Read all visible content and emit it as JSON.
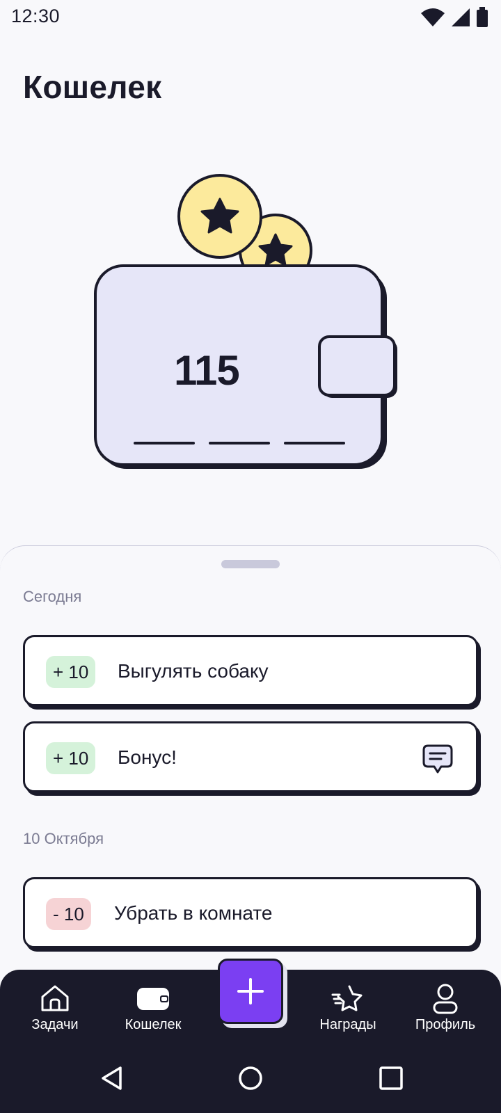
{
  "status_bar": {
    "time": "12:30",
    "icons": [
      "wifi-icon",
      "cellular-signal-icon",
      "battery-icon"
    ]
  },
  "header": {
    "title": "Кошелек"
  },
  "wallet": {
    "balance": "115",
    "illustration_icons": [
      "star-coin-icon",
      "star-coin-icon",
      "wallet-icon"
    ]
  },
  "colors": {
    "background": "#F8F8FB",
    "ink": "#1A1A2A",
    "wallet_fill": "#E6E6F8",
    "coin_fill": "#FCEA9C",
    "plus_badge": "#D5F2DA",
    "minus_badge": "#F6D3D5",
    "accent": "#7B3FF2"
  },
  "transactions": {
    "groups": [
      {
        "date": "Сегодня",
        "items": [
          {
            "amount": "+ 10",
            "title": "Выгулять собаку",
            "type": "plus",
            "has_comment": false
          },
          {
            "amount": "+ 10",
            "title": "Бонус!",
            "type": "plus",
            "has_comment": true,
            "comment_icon": "message-icon"
          }
        ]
      },
      {
        "date": "10 Октября",
        "items": [
          {
            "amount": "- 10",
            "title": "Убрать в комнате",
            "type": "minus",
            "has_comment": false
          }
        ]
      }
    ]
  },
  "bottom_nav": {
    "items": [
      {
        "label": "Задачи",
        "icon": "home-icon"
      },
      {
        "label": "Кошелек",
        "icon": "wallet-icon",
        "active": true
      },
      {
        "label": "Награды",
        "icon": "star-icon"
      },
      {
        "label": "Профиль",
        "icon": "profile-icon"
      }
    ],
    "fab_icon": "plus-icon"
  },
  "system_nav": [
    "back-icon",
    "home-circle-icon",
    "recents-icon"
  ]
}
